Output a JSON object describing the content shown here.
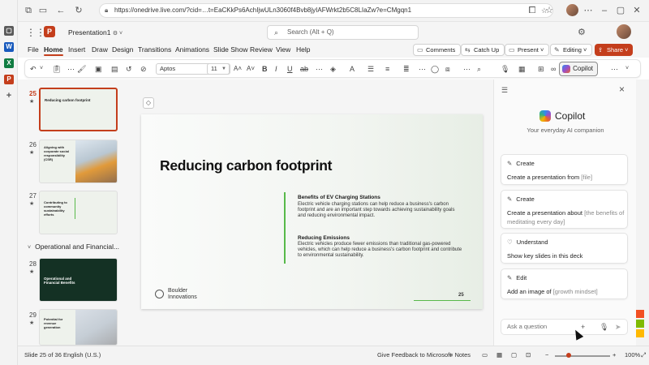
{
  "browser": {
    "url": "https://onedrive.live.com/?cid=…t=EaCKkPs6AchIjwULn3060f4Bvb8jyIAFWrkt2b5C8LIaZw?e=CMgqn1",
    "icons": [
      "collections-icon",
      "tabs-icon",
      "back-icon",
      "refresh-icon",
      "lock-icon",
      "favorite-star-icon",
      "extensions-icon",
      "favorites-icon",
      "more-icon",
      "minimize-icon",
      "maximize-icon",
      "close-icon"
    ]
  },
  "app": {
    "doc_title": "Presentation1",
    "search_placeholder": "Search (Alt + Q)",
    "brand_color": "#c43e1c"
  },
  "menu": {
    "tabs": [
      "File",
      "Home",
      "Insert",
      "Draw",
      "Design",
      "Transitions",
      "Animations",
      "Slide Show",
      "Review",
      "View",
      "Help"
    ],
    "active_tab": "Home",
    "comments": "Comments",
    "catch_up": "Catch Up",
    "present": "Present",
    "editing": "Editing",
    "share": "Share"
  },
  "ribbon": {
    "font_name": "Aptos",
    "font_size": "11",
    "bold": "B",
    "copilot": "Copilot"
  },
  "thumbnails": [
    {
      "num": "25",
      "title": "Reducing carbon footprint",
      "selected": true
    },
    {
      "num": "26",
      "title": "Aligning with corporate social responsibility (CSR)"
    },
    {
      "num": "27",
      "title": "Contributing to community sustainability efforts"
    },
    {
      "num": "28",
      "title": "Operational and Financial Benefits"
    },
    {
      "num": "29",
      "title": "Potential for revenue generation"
    }
  ],
  "section": "Operational and Financial...",
  "slide": {
    "title": "Reducing carbon footprint",
    "bullets": [
      {
        "heading": "Benefits of EV Charging Stations",
        "text": "Electric vehicle charging stations can help reduce a business's carbon footprint and are an important step towards achieving sustainability goals and reducing environmental impact."
      },
      {
        "heading": "Reducing Emissions",
        "text": "Electric vehicles produce fewer emissions than traditional gas-powered vehicles, which can help reduce a business's carbon footprint and contribute to environmental sustainability."
      }
    ],
    "logo_line1": "Boulder",
    "logo_line2": "Innovations",
    "number": "25"
  },
  "copilot": {
    "name": "Copilot",
    "subtitle": "Your everyday AI companion",
    "cards": [
      {
        "heading": "Create",
        "text": "Create a presentation from ",
        "hint": "[file]"
      },
      {
        "heading": "Create",
        "text": "Create a presentation about ",
        "hint": "[the benefits of meditating every day]"
      },
      {
        "heading": "Understand",
        "text": "Show key slides in this deck",
        "hint": ""
      },
      {
        "heading": "Edit",
        "text": "Add an image of ",
        "hint": "[growth mindset]"
      }
    ],
    "ask_placeholder": "Ask a question"
  },
  "status": {
    "slide_of": "Slide 25 of 36",
    "language": "English (U.S.)",
    "feedback": "Give Feedback to Microsoft",
    "notes": "Notes",
    "zoom": "100%",
    "zoom_level": 0.25
  }
}
